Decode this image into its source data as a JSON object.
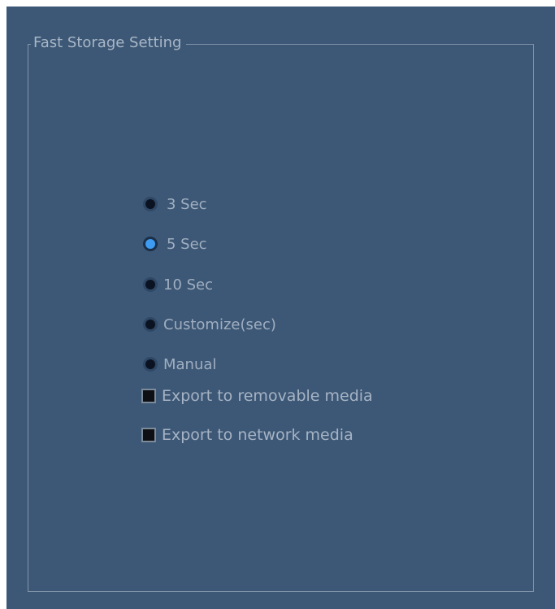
{
  "group": {
    "title": "Fast Storage Setting"
  },
  "options": [
    {
      "label": "3 Sec",
      "selected": false
    },
    {
      "label": "5 Sec",
      "selected": true
    },
    {
      "label": "10 Sec",
      "selected": false
    },
    {
      "label": "Customize(sec)",
      "selected": false
    },
    {
      "label": "Manual",
      "selected": false
    }
  ],
  "exports": [
    {
      "label": "Export to removable media",
      "checked": false
    },
    {
      "label": "Export to network media",
      "checked": false
    }
  ],
  "colors": {
    "panel_bg": "#3d5876",
    "radio_selected": "#3d9bf2",
    "text": "#a0aec0"
  }
}
